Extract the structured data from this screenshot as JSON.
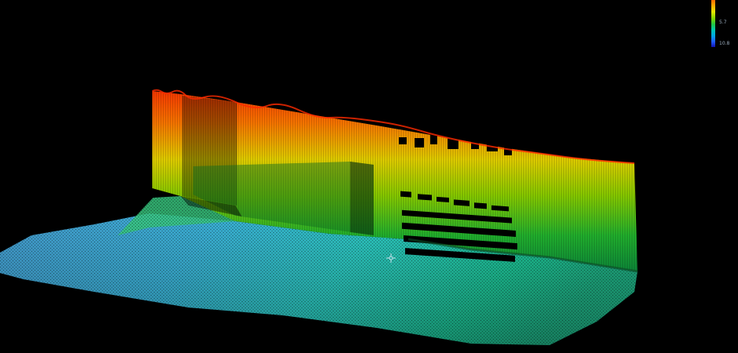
{
  "scale": {
    "label_mid": "5.7",
    "label_max": "10.8",
    "gradient_colors": [
      "#ff6a00",
      "#ffa000",
      "#e6e600",
      "#7dd400",
      "#1fc84a",
      "#00c8b4",
      "#00a8e6",
      "#2060ff",
      "#1010b0"
    ]
  },
  "viewer": {
    "background": "#000000",
    "marker_icon": "crosshair-icon"
  }
}
